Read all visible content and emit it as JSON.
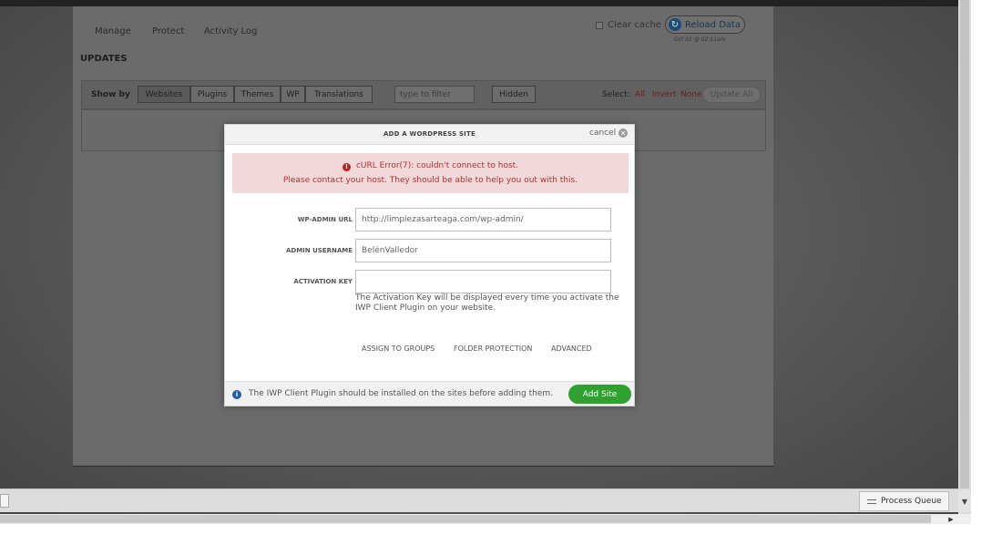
{
  "nav": {
    "manage": "Manage",
    "protect": "Protect",
    "activity_log": "Activity Log"
  },
  "header": {
    "clear_cache": "Clear cache",
    "reload_data": "Reload Data",
    "reload_time": "Oct 01 @ 02:11am"
  },
  "updates": {
    "title": "UPDATES",
    "show_by": "Show by",
    "tabs": [
      "Websites",
      "Plugins",
      "Themes",
      "WP",
      "Translations"
    ],
    "filter_placeholder": "type to filter",
    "hidden_label": "Hidden",
    "select_label": "Select:",
    "select_all": "All",
    "select_invert": "Invert",
    "select_none": "None",
    "update_all": "Update All"
  },
  "modal": {
    "title": "ADD A WORDPRESS SITE",
    "cancel": "cancel",
    "error_line1": "cURL Error(7): couldn't connect to host.",
    "error_line2": "Please contact your host. They should be able to help you out with this.",
    "fields": {
      "url_label": "WP-ADMIN URL",
      "url_value": "http://limpiezasarteaga.com/wp-admin/",
      "username_label": "ADMIN USERNAME",
      "username_value": "BelénValledor",
      "key_label": "ACTIVATION KEY",
      "key_value": ""
    },
    "help_text": "The Activation Key will be displayed every time you activate the IWP Client Plugin on your website.",
    "links": {
      "groups": "ASSIGN TO GROUPS",
      "folder": "FOLDER PROTECTION",
      "advanced": "ADVANCED"
    },
    "footer_text": "The IWP Client Plugin should be installed on the sites before adding them.",
    "add_site": "Add Site"
  },
  "statusbar": {
    "process_queue": "Process Queue"
  },
  "colors": {
    "error_bg": "#f2d8d8",
    "error_text": "#b13131",
    "add_site": "#2fa12f",
    "info_icon": "#1f5ea8"
  }
}
